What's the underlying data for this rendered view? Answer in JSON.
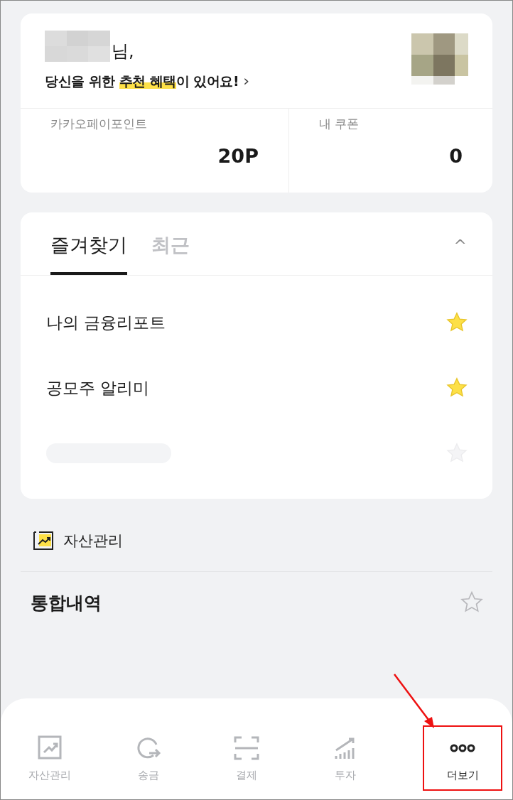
{
  "greeting": {
    "suffix": "님,",
    "message": "당신을 위한 **추천 혜택**이 있어요!",
    "arrow": "›"
  },
  "summary": [
    {
      "label": "카카오페이포인트",
      "value": "20P"
    },
    {
      "label": "내 쿠폰",
      "value": "0"
    }
  ],
  "favorites": {
    "tabs": [
      {
        "label": "즐겨찾기",
        "selected": true
      },
      {
        "label": "최근",
        "selected": false
      }
    ],
    "collapse": "^",
    "items": [
      {
        "kind": "item",
        "label": "나의 금융리포트",
        "starred": true
      },
      {
        "kind": "item",
        "label": "공모주 알리미",
        "starred": true
      },
      {
        "kind": "skeleton",
        "starred": false
      }
    ]
  },
  "section": {
    "title": "자산관리",
    "items": [
      {
        "label": "통합내역",
        "starred": false
      }
    ]
  },
  "bottom_nav": [
    {
      "label": "자산관리",
      "kind": "chart",
      "selected": false,
      "highlighted": false
    },
    {
      "label": "송금",
      "kind": "send",
      "selected": false,
      "highlighted": false
    },
    {
      "label": "결제",
      "kind": "scan",
      "selected": false,
      "highlighted": false
    },
    {
      "label": "투자",
      "kind": "invest",
      "selected": false,
      "highlighted": false
    },
    {
      "label": "더보기",
      "kind": "more",
      "selected": true,
      "highlighted": true
    }
  ]
}
